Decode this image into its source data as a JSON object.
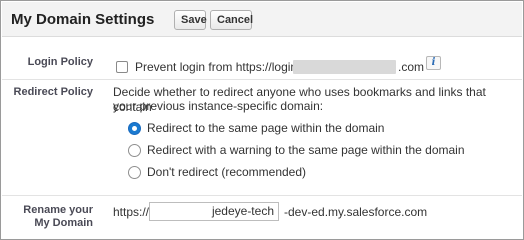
{
  "header": {
    "title": "My Domain Settings",
    "save_label": "Save",
    "cancel_label": "Cancel"
  },
  "login_policy": {
    "label": "Login Policy",
    "checkbox_checked": false,
    "text_prefix": "Prevent login from https://login.",
    "text_suffix": ".com",
    "info_icon": "info-icon",
    "info_glyph": "i"
  },
  "redirect_policy": {
    "label": "Redirect Policy",
    "description_line1": "Decide whether to redirect anyone who uses bookmarks and links that contain",
    "description_line2": "your previous instance-specific domain:",
    "options": [
      {
        "label": "Redirect to the same page within the domain",
        "selected": true
      },
      {
        "label": "Redirect with a warning to the same page within the domain",
        "selected": false
      },
      {
        "label": "Don't redirect (recommended)",
        "selected": false
      }
    ]
  },
  "rename": {
    "label_line1": "Rename your",
    "label_line2": "My Domain",
    "prefix": "https://",
    "value": "jedeye-tech",
    "suffix": "-dev-ed.my.salesforce.com"
  },
  "colors": {
    "accent": "#1a7ad0",
    "label": "#4a4a56",
    "header_bg": "#f3f3f3"
  }
}
